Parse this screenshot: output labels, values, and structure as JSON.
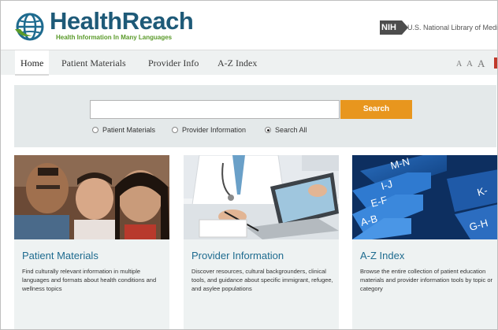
{
  "header": {
    "logo_title": "HealthReach",
    "logo_tagline": "Health Information In Many Languages",
    "nih_badge": "NIH",
    "nih_text": "U.S. National Library of Medic"
  },
  "nav": {
    "items": [
      {
        "label": "Home",
        "active": true
      },
      {
        "label": "Patient Materials",
        "active": false
      },
      {
        "label": "Provider Info",
        "active": false
      },
      {
        "label": "A-Z Index",
        "active": false
      }
    ],
    "text_size": [
      "A",
      "A",
      "A"
    ]
  },
  "search": {
    "value": "",
    "placeholder": "",
    "button_label": "Search",
    "options": [
      {
        "label": "Patient Materials",
        "checked": false
      },
      {
        "label": "Provider Information",
        "checked": false
      },
      {
        "label": "Search All",
        "checked": true
      }
    ]
  },
  "cards": [
    {
      "title": "Patient Materials",
      "description": "Find culturally relevant information in multiple languages and formats about health conditions and wellness topics"
    },
    {
      "title": "Provider Information",
      "description": "Discover resources, cultural backgrounders, clinical tools, and guidance about specific immigrant, refugee, and asylee populations"
    },
    {
      "title": "A-Z Index",
      "description": "Browse the entire collection of patient education materials and provider information tools by topic or category",
      "tab_letters": [
        "M-N",
        "I-J",
        "E-F",
        "A-B",
        "K-",
        "G-H"
      ]
    }
  ],
  "colors": {
    "brand_blue": "#1e5a78",
    "brand_green": "#5a9a2a",
    "search_orange": "#e8961e",
    "card_title_blue": "#1e6b8f",
    "panel_gray": "#e4e9ea"
  }
}
